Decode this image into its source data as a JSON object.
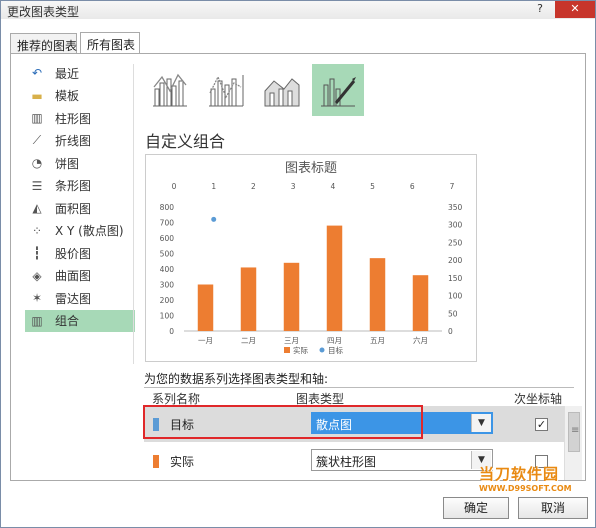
{
  "window": {
    "title": "更改图表类型",
    "help": "?",
    "close": "✕"
  },
  "tabs": [
    {
      "label": "推荐的图表"
    },
    {
      "label": "所有图表"
    }
  ],
  "nav": [
    {
      "label": "最近",
      "icon": "recent-icon"
    },
    {
      "label": "模板",
      "icon": "folder-icon"
    },
    {
      "label": "柱形图",
      "icon": "column-chart-icon"
    },
    {
      "label": "折线图",
      "icon": "line-chart-icon"
    },
    {
      "label": "饼图",
      "icon": "pie-chart-icon"
    },
    {
      "label": "条形图",
      "icon": "bar-chart-icon"
    },
    {
      "label": "面积图",
      "icon": "area-chart-icon"
    },
    {
      "label": "X Y (散点图)",
      "icon": "scatter-chart-icon"
    },
    {
      "label": "股价图",
      "icon": "stock-chart-icon"
    },
    {
      "label": "曲面图",
      "icon": "surface-chart-icon"
    },
    {
      "label": "雷达图",
      "icon": "radar-chart-icon"
    },
    {
      "label": "组合",
      "icon": "combo-chart-icon"
    }
  ],
  "selected_nav_index": 11,
  "combo_title": "自定义组合",
  "prompt": "为您的数据系列选择图表类型和轴:",
  "grid": {
    "headers": {
      "name": "系列名称",
      "type": "图表类型",
      "secondary": "次坐标轴"
    },
    "rows": [
      {
        "name": "目标",
        "type": "散点图",
        "secondary": true,
        "color": "#5b9bd5"
      },
      {
        "name": "实际",
        "type": "簇状柱形图",
        "secondary": false,
        "color": "#ed7d31"
      }
    ]
  },
  "buttons": {
    "ok": "确定",
    "cancel": "取消"
  },
  "watermark": {
    "line1": "当刀软件园",
    "line2": "WWW.D99SOFT.COM"
  },
  "chart_data": {
    "type": "bar",
    "title": "图表标题",
    "categories": [
      "一月",
      "二月",
      "三月",
      "四月",
      "五月",
      "六月"
    ],
    "series": [
      {
        "name": "实际",
        "type": "bar",
        "axis": "primary",
        "values": [
          300,
          410,
          440,
          680,
          470,
          360
        ],
        "color": "#ed7d31"
      },
      {
        "name": "目标",
        "type": "scatter",
        "axis": "secondary",
        "points": [
          {
            "x": 1,
            "y": 315
          }
        ],
        "color": "#5b9bd5"
      }
    ],
    "y_primary": {
      "min": 0,
      "max": 800,
      "ticks": [
        0,
        100,
        200,
        300,
        400,
        500,
        600,
        700,
        800
      ]
    },
    "y_secondary": {
      "min": 0,
      "max": 350,
      "ticks": [
        0,
        50,
        100,
        150,
        200,
        250,
        300,
        350
      ]
    },
    "x_secondary": {
      "min": 0,
      "max": 7,
      "ticks": [
        0,
        1,
        2,
        3,
        4,
        5,
        6,
        7
      ]
    },
    "legend": "bottom"
  }
}
